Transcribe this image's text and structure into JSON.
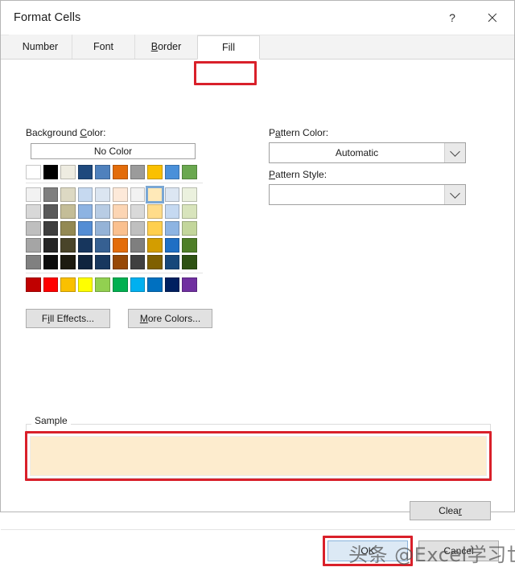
{
  "window": {
    "title": "Format Cells",
    "help_icon": "?",
    "close_icon": "close-x"
  },
  "tabs": [
    {
      "label": "Number",
      "accel": "",
      "active": false
    },
    {
      "label": "Font",
      "accel": "",
      "active": false
    },
    {
      "label": "Border",
      "accel": "B",
      "active": false
    },
    {
      "label": "Fill",
      "accel": "",
      "active": true
    }
  ],
  "background": {
    "label": "Background Color:",
    "label_pre": "Background ",
    "label_accel": "C",
    "label_post": "olor:",
    "no_color_label": "No Color"
  },
  "pattern": {
    "color_label_pre": "P",
    "color_label_accel": "a",
    "color_label_post": "ttern Color:",
    "color_value": "Automatic",
    "style_label_accel": "P",
    "style_label_post": "attern Style:",
    "style_value": ""
  },
  "buttons": {
    "fill_effects_pre": "F",
    "fill_effects_accel": "i",
    "fill_effects_post": "ll Effects...",
    "more_colors_accel": "M",
    "more_colors_post": "ore Colors...",
    "clear_pre": "Clea",
    "clear_accel": "r",
    "ok": "OK",
    "cancel": "Cancel"
  },
  "sample": {
    "legend": "Sample",
    "fill_color": "#fdecce"
  },
  "watermark": {
    "text": "头条 @Excel学习世界"
  },
  "annotation": {
    "color": "#d9202a",
    "targets": [
      "fill-tab",
      "sample-box",
      "ok-button"
    ]
  },
  "palette": {
    "theme_row": [
      "#ffffff",
      "#000000",
      "#eeece1",
      "#1f497d",
      "#4f81bd",
      "#e36c0a",
      "#9b9b9b",
      "#fac000",
      "#4a90d9",
      "#6aa84f"
    ],
    "tint_rows": [
      [
        "#f2f2f2",
        "#7f7f7f",
        "#ddd9c3",
        "#c6d9f0",
        "#dbe5f1",
        "#fde9d9",
        "#f2f2f2",
        "#ffe9b8",
        "#dce6f2",
        "#ebf1de"
      ],
      [
        "#d8d8d8",
        "#595959",
        "#c4bd97",
        "#8db3e2",
        "#b8cce4",
        "#fcd5b4",
        "#d9d9d9",
        "#ffdc8a",
        "#c5d9f1",
        "#d8e4bc"
      ],
      [
        "#bfbfbf",
        "#3f3f3f",
        "#938953",
        "#548dd4",
        "#95b3d7",
        "#fac08f",
        "#bfbfbf",
        "#ffcf4d",
        "#8db4e2",
        "#c3d69b"
      ],
      [
        "#a5a5a5",
        "#262626",
        "#494429",
        "#17365d",
        "#366092",
        "#e36c0a",
        "#7f7f7f",
        "#d39d00",
        "#1f6fc4",
        "#4f7f28"
      ],
      [
        "#808080",
        "#0c0c0c",
        "#1d1b10",
        "#0f243e",
        "#17375e",
        "#974806",
        "#404040",
        "#7f6000",
        "#17477a",
        "#2e5213"
      ]
    ],
    "standard_row": [
      "#c00000",
      "#ff0000",
      "#fac000",
      "#ffff00",
      "#92d050",
      "#00b050",
      "#00b0f0",
      "#0070c0",
      "#002060",
      "#7030a0"
    ],
    "selected": {
      "row": 0,
      "index": 7
    }
  }
}
